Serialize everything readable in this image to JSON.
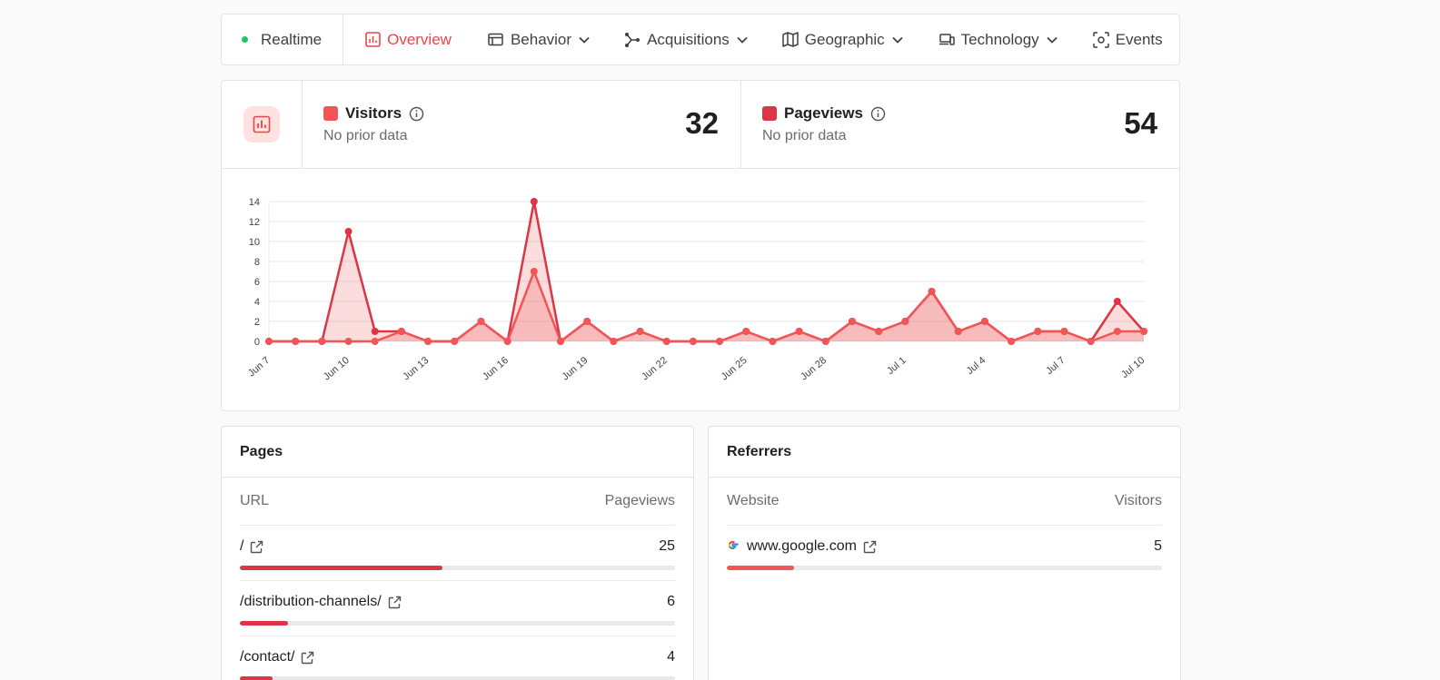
{
  "nav": {
    "realtime": "Realtime",
    "overview": "Overview",
    "behavior": "Behavior",
    "acquisitions": "Acquisitions",
    "geographic": "Geographic",
    "technology": "Technology",
    "events": "Events"
  },
  "colors": {
    "visitors": "#f25555",
    "pageviews": "#dc3545",
    "accent": "#ef4444",
    "online": "#22c55e"
  },
  "metrics": {
    "visitors": {
      "label": "Visitors",
      "sub": "No prior data",
      "value": "32"
    },
    "pageviews": {
      "label": "Pageviews",
      "sub": "No prior data",
      "value": "54"
    }
  },
  "chart_data": {
    "type": "area",
    "x": [
      "Jun 7",
      "Jun 8",
      "Jun 9",
      "Jun 10",
      "Jun 11",
      "Jun 12",
      "Jun 13",
      "Jun 14",
      "Jun 15",
      "Jun 16",
      "Jun 17",
      "Jun 18",
      "Jun 19",
      "Jun 20",
      "Jun 21",
      "Jun 22",
      "Jun 23",
      "Jun 24",
      "Jun 25",
      "Jun 26",
      "Jun 27",
      "Jun 28",
      "Jun 29",
      "Jun 30",
      "Jul 1",
      "Jul 2",
      "Jul 3",
      "Jul 4",
      "Jul 5",
      "Jul 6",
      "Jul 7",
      "Jul 8",
      "Jul 9",
      "Jul 10"
    ],
    "tick_labels": [
      "Jun 7",
      "Jun 10",
      "Jun 13",
      "Jun 16",
      "Jun 19",
      "Jun 22",
      "Jun 25",
      "Jun 28",
      "Jul 1",
      "Jul 4",
      "Jul 7",
      "Jul 10"
    ],
    "series": [
      {
        "name": "Pageviews",
        "values": [
          0,
          0,
          0,
          11,
          1,
          1,
          0,
          0,
          2,
          0,
          14,
          0,
          2,
          0,
          1,
          0,
          0,
          0,
          1,
          0,
          1,
          0,
          2,
          1,
          2,
          5,
          1,
          2,
          0,
          1,
          1,
          0,
          4,
          1
        ]
      },
      {
        "name": "Visitors",
        "values": [
          0,
          0,
          0,
          0,
          0,
          1,
          0,
          0,
          2,
          0,
          7,
          0,
          2,
          0,
          1,
          0,
          0,
          0,
          1,
          0,
          1,
          0,
          2,
          1,
          2,
          5,
          1,
          2,
          0,
          1,
          1,
          0,
          1,
          1
        ]
      }
    ],
    "ylim": [
      0,
      14
    ],
    "yticks": [
      0,
      2,
      4,
      6,
      8,
      10,
      12,
      14
    ],
    "grid": true
  },
  "pages": {
    "title": "Pages",
    "col_left": "URL",
    "col_right": "Pageviews",
    "rows": [
      {
        "label": "/",
        "value": "25",
        "fraction": 0.465
      },
      {
        "label": "/distribution-channels/",
        "value": "6",
        "fraction": 0.11
      },
      {
        "label": "/contact/",
        "value": "4",
        "fraction": 0.075
      }
    ]
  },
  "referrers": {
    "title": "Referrers",
    "col_left": "Website",
    "col_right": "Visitors",
    "rows": [
      {
        "label": "www.google.com",
        "value": "5",
        "fraction": 0.155
      }
    ]
  }
}
